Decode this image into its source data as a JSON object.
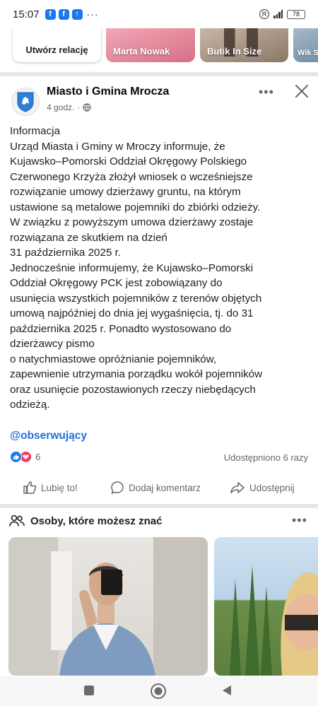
{
  "status_bar": {
    "time": "15:07",
    "dots": "···",
    "battery": "78"
  },
  "stories": [
    {
      "label": "Utwórz relację"
    },
    {
      "label": "Marta Nowak"
    },
    {
      "label": "Butik In Size"
    },
    {
      "label": "Wik Szcz"
    }
  ],
  "post": {
    "author": "Miasto i Gmina Mrocza",
    "time": "4 godz.",
    "separator": "·",
    "lines": [
      "Informacja",
      "Urząd Miasta i Gminy w Mroczy informuje, że",
      "Kujawsko–Pomorski Oddział Okręgowy Polskiego",
      "Czerwonego Krzyża złożył wniosek o wcześniejsze",
      "rozwiązanie umowy dzierżawy gruntu, na którym",
      "ustawione są metalowe pojemniki do zbiórki odzieży.",
      "W związku z powyższym umowa dzierżawy zostaje",
      "rozwiązana ze skutkiem na dzień",
      "31 października 2025 r.",
      "Jednocześnie informujemy, że Kujawsko–Pomorski",
      "Oddział Okręgowy PCK jest zobowiązany do",
      "usunięcia wszystkich pojemników z terenów objętych",
      "umową najpóźniej do dnia jej wygaśnięcia, tj. do 31",
      "października 2025 r. Ponadto wystosowano do",
      "dzierżawcy pismo",
      "o natychmiastowe opróżnianie pojemników,",
      "zapewnienie utrzymania porządku wokół pojemników",
      "oraz usunięcie pozostawionych rzeczy niebędących",
      "odzieżą."
    ],
    "hashtag": "@obserwujący",
    "reaction_count": "6",
    "shares": "Udostępniono 6 razy",
    "actions": {
      "like": "Lubię to!",
      "comment": "Dodaj komentarz",
      "share": "Udostępnij"
    }
  },
  "pymk": {
    "title": "Osoby, które możesz znać"
  },
  "colors": {
    "brand_blue": "#1877f2",
    "love_red": "#f33e58",
    "link_blue": "#216fdb"
  }
}
